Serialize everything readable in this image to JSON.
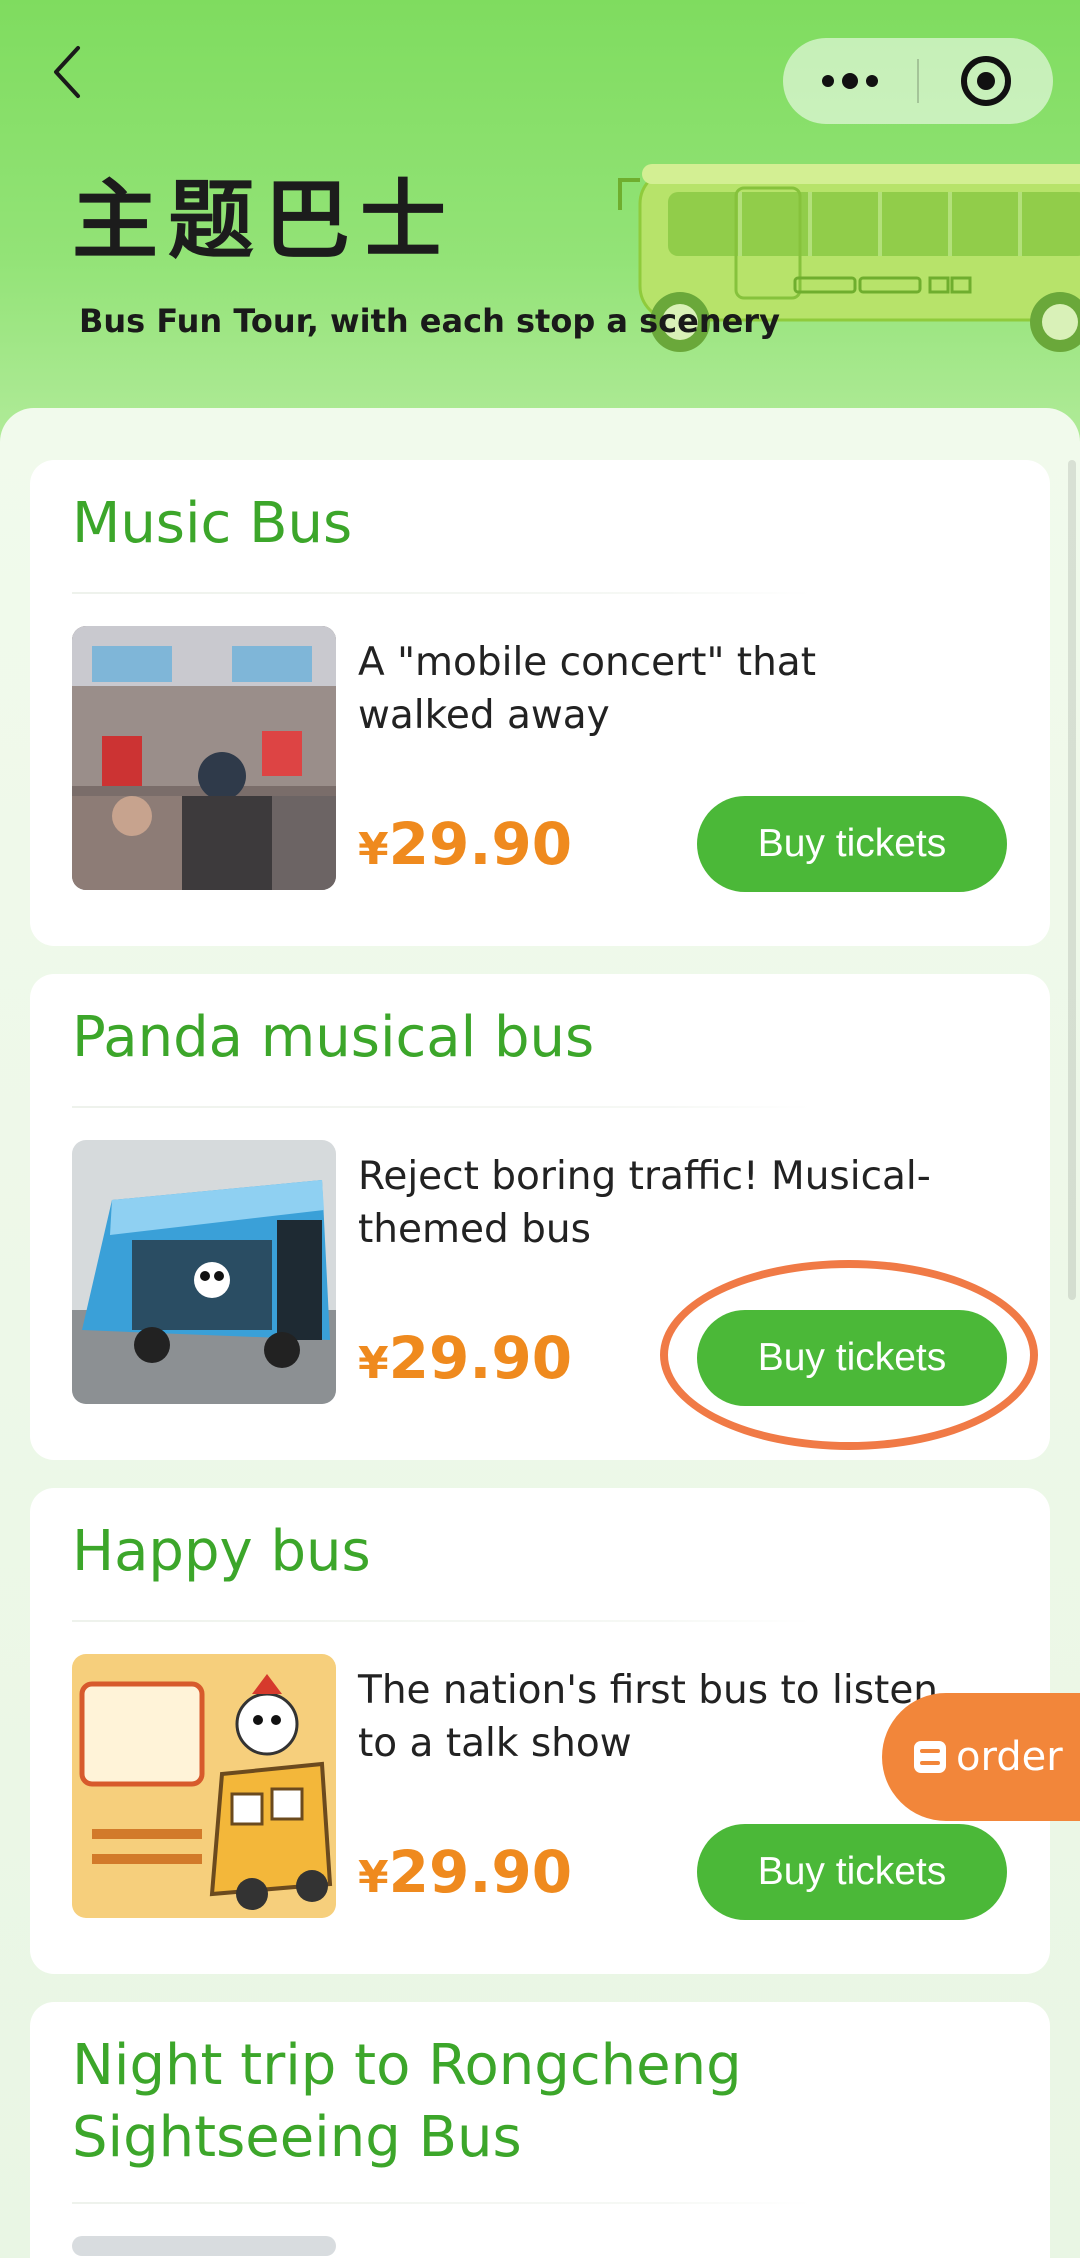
{
  "nav": {
    "back_icon": "chevron-left-icon",
    "more_icon": "more-dots-icon",
    "close_icon": "target-circle-icon"
  },
  "hero": {
    "title": "主题巴士",
    "subtitle": "Bus Fun Tour, with each stop a scenery"
  },
  "cards": [
    {
      "title": "Music Bus",
      "description": "A \"mobile concert\" that walked away",
      "currency": "¥",
      "price": "29.90",
      "button_label": "Buy tickets"
    },
    {
      "title": "Panda musical bus",
      "description": "Reject boring traffic! Musical-themed bus",
      "currency": "¥",
      "price": "29.90",
      "button_label": "Buy tickets"
    },
    {
      "title": "Happy bus",
      "description": "The nation's first bus to listen to a talk show",
      "currency": "¥",
      "price": "29.90",
      "button_label": "Buy tickets"
    },
    {
      "title": "Night trip to Rongcheng Sightseeing Bus"
    }
  ],
  "order_fab": {
    "icon": "order-list-icon",
    "label": "order"
  },
  "colors": {
    "header_green": "#7fdc5f",
    "title_green": "#3ca62a",
    "button_green": "#4bb838",
    "price_orange": "#ef8a1e",
    "fab_orange": "#f2863a",
    "highlight_ring": "#f07a46"
  }
}
